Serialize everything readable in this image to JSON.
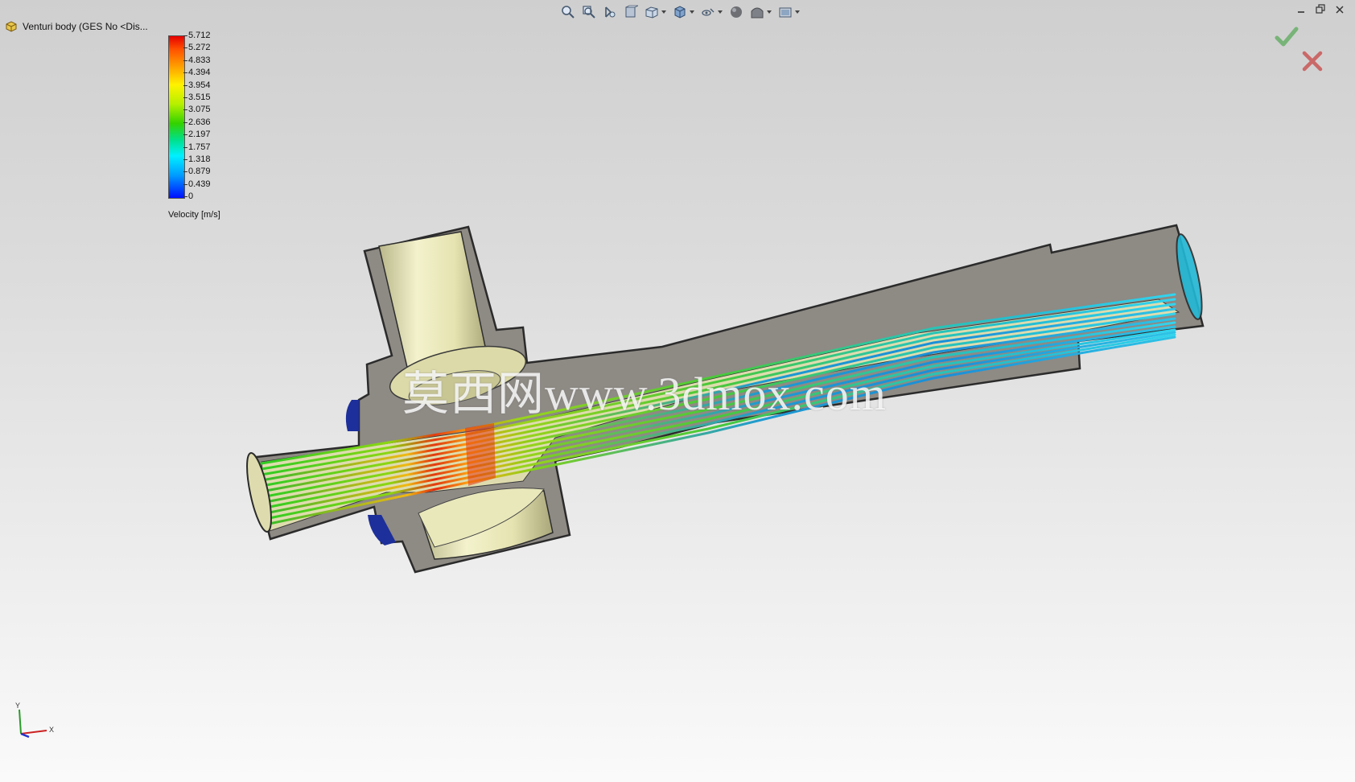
{
  "window": {
    "tree_item_label": "Venturi body  (GES No <Dis...",
    "tree_item_icon": "part-icon"
  },
  "toolbar": {
    "items": [
      {
        "icon": "zoom-to-fit-icon"
      },
      {
        "icon": "zoom-to-area-icon"
      },
      {
        "icon": "previous-view-icon"
      },
      {
        "icon": "section-view-icon"
      },
      {
        "icon": "view-orientation-icon",
        "dropdown": true
      },
      {
        "icon": "display-style-icon",
        "dropdown": true
      },
      {
        "icon": "hide-show-items-icon",
        "dropdown": true
      },
      {
        "icon": "edit-appearance-icon"
      },
      {
        "icon": "apply-scene-icon",
        "dropdown": true
      },
      {
        "icon": "view-settings-icon",
        "dropdown": true
      }
    ]
  },
  "legend": {
    "ticks": [
      "5.712",
      "5.272",
      "4.833",
      "4.394",
      "3.954",
      "3.515",
      "3.075",
      "2.636",
      "2.197",
      "1.757",
      "1.318",
      "0.879",
      "0.439",
      "0"
    ],
    "title": "Velocity [m/s]",
    "max": 5.712,
    "min": 0,
    "colors": [
      "#e60000",
      "#ff9a00",
      "#fff200",
      "#32d200",
      "#00f0ff",
      "#0010ff"
    ]
  },
  "watermark": {
    "text": "莫西网www.3dmox.com"
  },
  "triad": {
    "y_label": "Y",
    "x_label": "X"
  },
  "colors": {
    "section_cut": "#8e8a84",
    "inner_surface": "#e7e6b3",
    "confirm": "#2f9a2f",
    "cancel": "#c62222"
  }
}
